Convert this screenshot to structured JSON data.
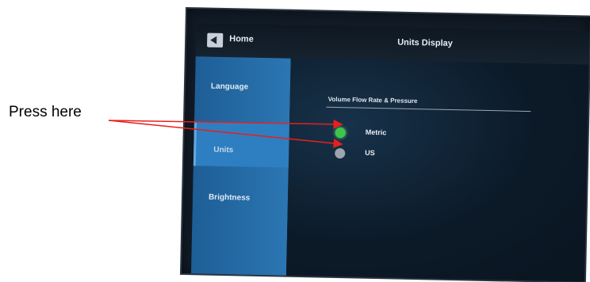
{
  "annotation": {
    "text": "Press here",
    "arrow_color": "#e8201c"
  },
  "device": {
    "header": {
      "home_label": "Home",
      "title": "Units Display",
      "home_icon": "back-home-icon"
    },
    "sidebar": {
      "items": [
        {
          "label": "Language",
          "selected": false
        },
        {
          "label": "Units",
          "selected": true
        },
        {
          "label": "Brightness",
          "selected": false
        }
      ]
    },
    "content": {
      "section_title": "Volume Flow Rate & Pressure",
      "options": [
        {
          "label": "Metric",
          "selected": true,
          "color": "#3fc44d"
        },
        {
          "label": "US",
          "selected": false,
          "color": "#9ba5ad"
        }
      ]
    }
  }
}
